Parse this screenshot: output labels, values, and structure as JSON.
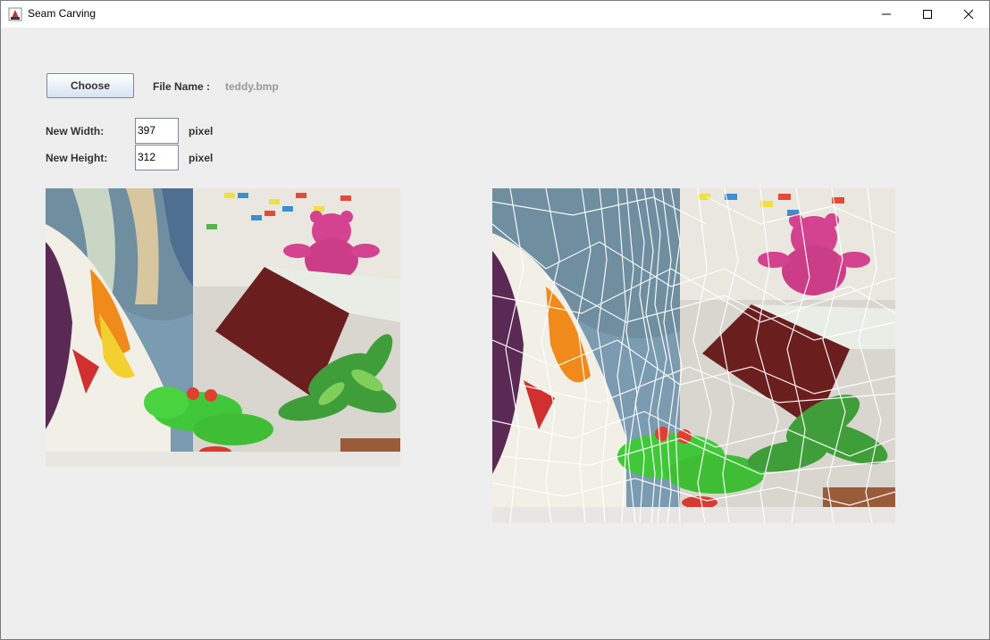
{
  "window": {
    "title": "Seam Carving",
    "controls": [
      "minimize-icon",
      "maximize-icon",
      "close-icon"
    ]
  },
  "controls": {
    "choose_label": "Choose",
    "file_name_label": "File Name :",
    "file_name_value": "teddy.bmp",
    "new_width_label": "New Width:",
    "new_width_value": "397",
    "new_height_label": "New Height:",
    "new_height_value": "312",
    "unit_label": "pixel"
  },
  "images": {
    "original": "teddy image (original)",
    "carved": "teddy image with seams overlay"
  }
}
